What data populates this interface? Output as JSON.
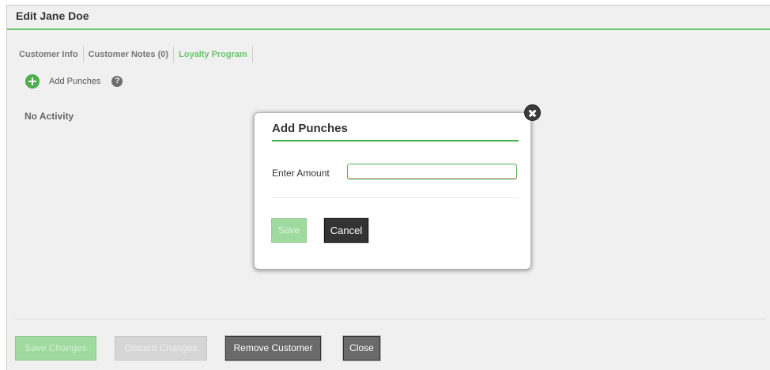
{
  "page": {
    "title": "Edit Jane Doe"
  },
  "tabs": [
    {
      "label": "Customer Info",
      "active": false
    },
    {
      "label": "Customer Notes (0)",
      "active": false
    },
    {
      "label": "Loyalty Program",
      "active": true
    }
  ],
  "toolbar": {
    "add_punches_label": "Add Punches",
    "add_icon": "plus-circle-icon",
    "help_icon": "question-circle-icon",
    "help_glyph": "?"
  },
  "activity": {
    "empty_text": "No Activity"
  },
  "footer": {
    "save_changes_label": "Save Changes",
    "discard_changes_label": "Discard Changes",
    "remove_customer_label": "Remove Customer",
    "close_label": "Close"
  },
  "modal": {
    "title": "Add Punches",
    "amount_label": "Enter Amount",
    "amount_value": "",
    "amount_placeholder": "",
    "save_label": "Save",
    "cancel_label": "Cancel",
    "close_icon": "close-circle-icon"
  },
  "colors": {
    "accent_green": "#4cae4c",
    "disabled_green": "#9fdb9f",
    "dark_button": "#333333"
  }
}
